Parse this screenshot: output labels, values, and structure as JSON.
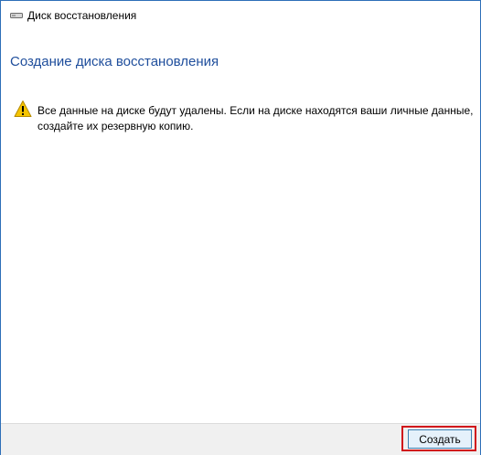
{
  "window": {
    "title": "Диск восстановления",
    "title_icon": "drive-icon"
  },
  "main": {
    "heading": "Создание диска восстановления",
    "warning_icon": "warning-icon",
    "warning_message": "Все данные на диске будут удалены. Если на диске находятся ваши личные данные, создайте их резервную копию."
  },
  "footer": {
    "create_label": "Создать"
  },
  "colors": {
    "heading": "#1f4e9c",
    "window_border": "#2d6fb8",
    "highlight": "#d0151b",
    "warning": "#f5c400"
  }
}
